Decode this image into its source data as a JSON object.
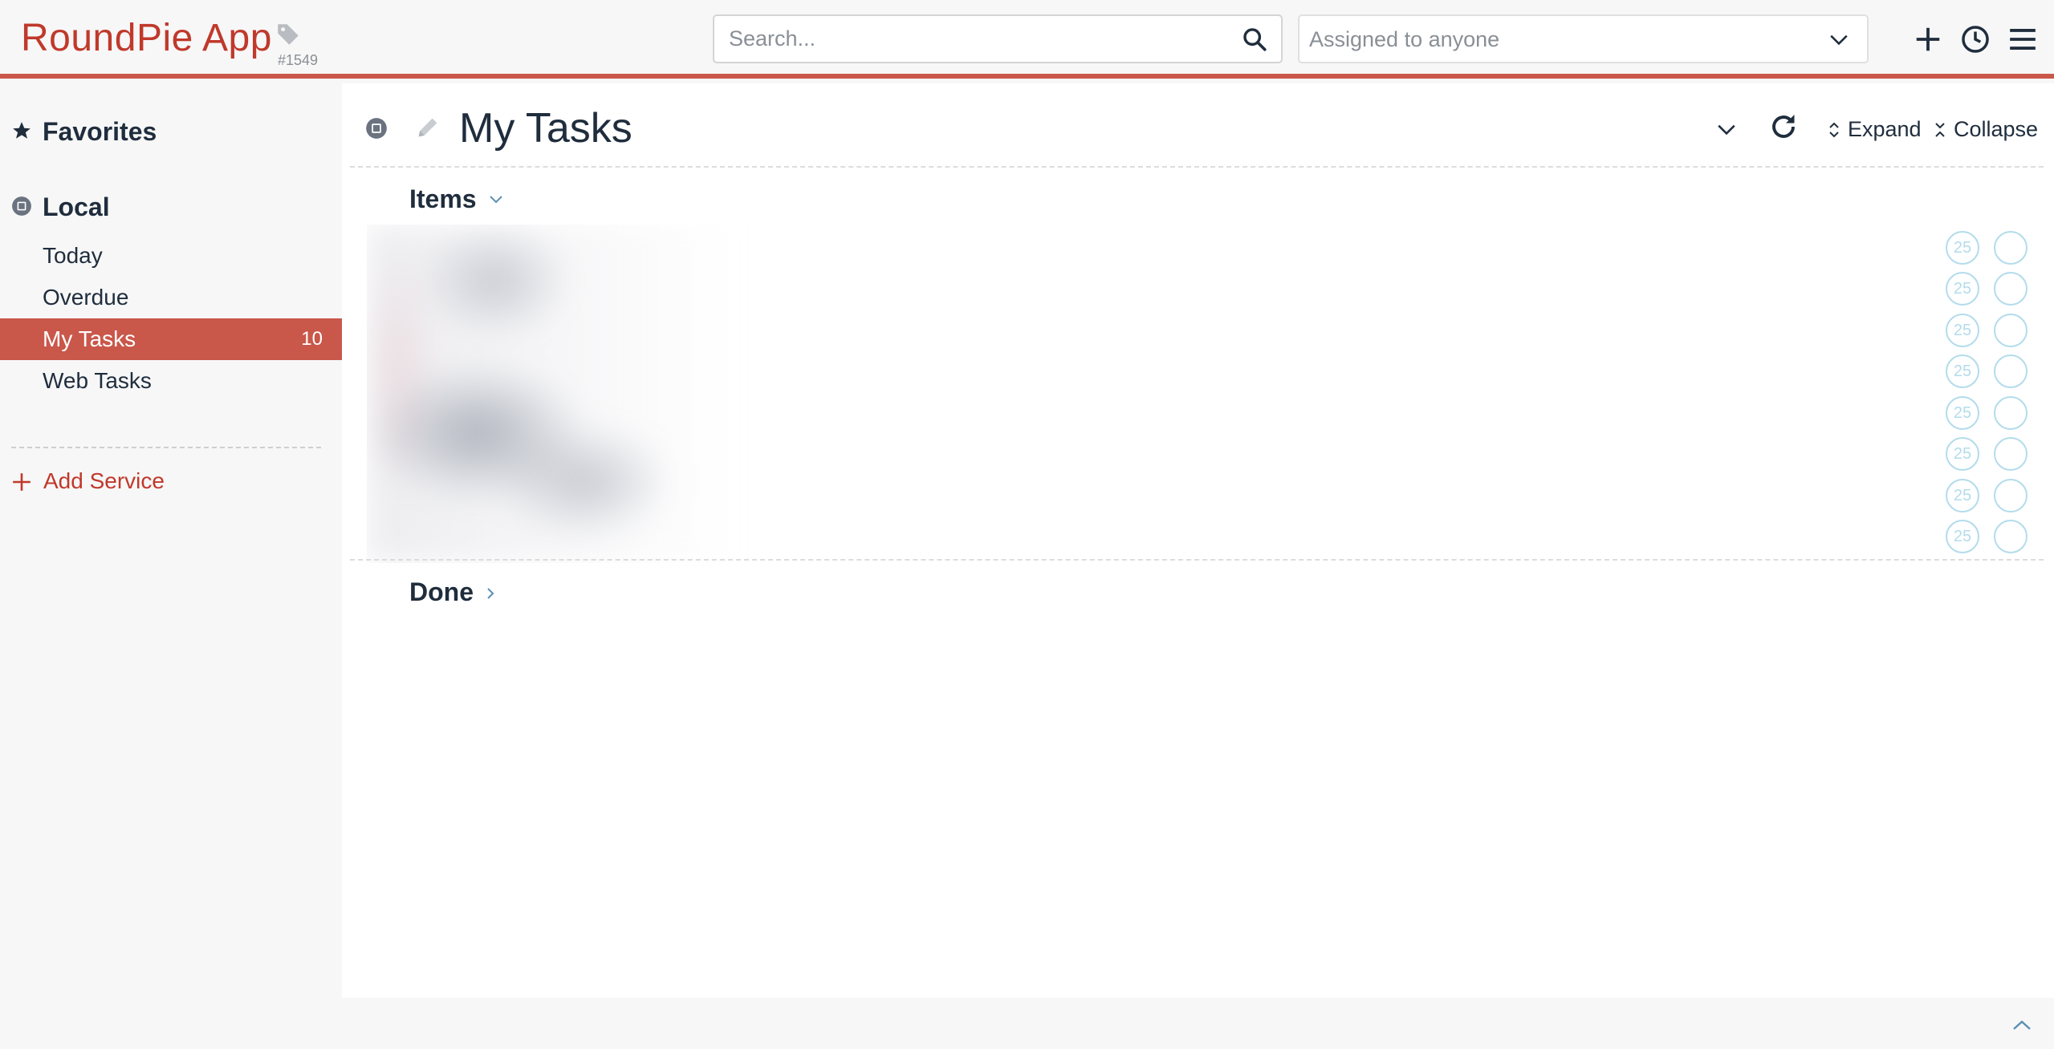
{
  "app": {
    "title": "RoundPie App",
    "build": "#1549"
  },
  "search": {
    "placeholder": "Search..."
  },
  "assignee_filter": {
    "selected": "Assigned to anyone"
  },
  "sidebar": {
    "favorites_label": "Favorites",
    "local_label": "Local",
    "items": [
      {
        "label": "Today",
        "count": ""
      },
      {
        "label": "Overdue",
        "count": ""
      },
      {
        "label": "My Tasks",
        "count": "10"
      },
      {
        "label": "Web Tasks",
        "count": ""
      }
    ],
    "add_service_label": "Add Service"
  },
  "main": {
    "title": "My Tasks",
    "expand_label": "Expand",
    "collapse_label": "Collapse",
    "groups": {
      "items_label": "Items",
      "done_label": "Done"
    },
    "rows": [
      {
        "pomodoro": "25"
      },
      {
        "pomodoro": "25"
      },
      {
        "pomodoro": "25"
      },
      {
        "pomodoro": "25"
      },
      {
        "pomodoro": "25"
      },
      {
        "pomodoro": "25"
      },
      {
        "pomodoro": "25"
      },
      {
        "pomodoro": "25"
      }
    ]
  },
  "colors": {
    "accent": "#c9574a",
    "brand_text": "#c0392b",
    "text": "#1f2d3d",
    "muted": "#8a8f96",
    "row_badge": "#b3dceb"
  },
  "icons": {
    "brand": "tag-icon",
    "search": "search-icon",
    "dropdown": "chevron-down-icon",
    "add": "plus-icon",
    "history": "clock-icon",
    "menu": "hamburger-menu-icon",
    "favorites": "star-icon",
    "local": "list-icon",
    "edit": "pencil-icon",
    "refresh": "refresh-icon",
    "expand": "expand-icon",
    "collapse": "collapse-icon",
    "scroll_top": "chevron-up-icon"
  }
}
